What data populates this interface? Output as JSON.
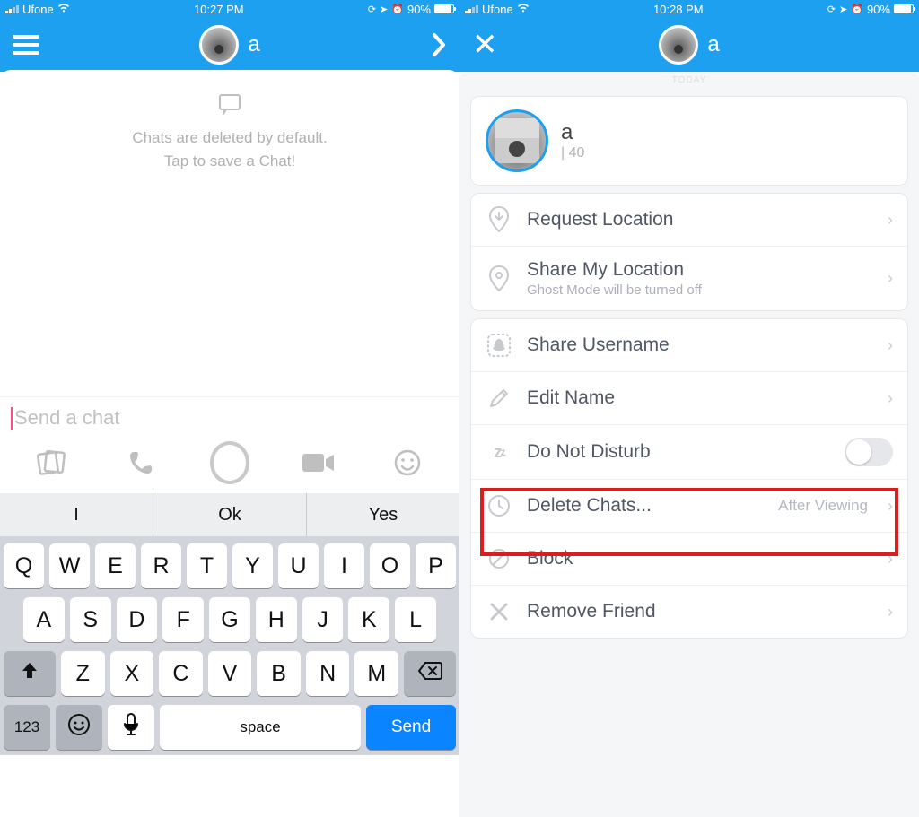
{
  "status": {
    "carrier": "Ufone",
    "time_left": "10:27 PM",
    "time_right": "10:28 PM",
    "battery_pct": "90%"
  },
  "nav": {
    "name_left": "a",
    "name_right": "a"
  },
  "chat": {
    "empty_line1": "Chats are deleted by default.",
    "empty_line2": "Tap to save a Chat!",
    "placeholder": "Send a chat"
  },
  "keyboard": {
    "sug1": "I",
    "sug2": "Ok",
    "sug3": "Yes",
    "row1": [
      "Q",
      "W",
      "E",
      "R",
      "T",
      "Y",
      "U",
      "I",
      "O",
      "P"
    ],
    "row2": [
      "A",
      "S",
      "D",
      "F",
      "G",
      "H",
      "J",
      "K",
      "L"
    ],
    "row3": [
      "Z",
      "X",
      "C",
      "V",
      "B",
      "N",
      "M"
    ],
    "num": "123",
    "space": "space",
    "send": "Send"
  },
  "sheet": {
    "today": "TODAY",
    "profile_name": "a",
    "profile_sub": "| 40",
    "req_location": "Request Location",
    "share_location": "Share My Location",
    "share_location_sub": "Ghost Mode will be turned off",
    "share_username": "Share Username",
    "edit_name": "Edit Name",
    "dnd": "Do Not Disturb",
    "delete_chats": "Delete Chats...",
    "delete_value": "After Viewing",
    "block": "Block",
    "remove_friend": "Remove Friend"
  }
}
